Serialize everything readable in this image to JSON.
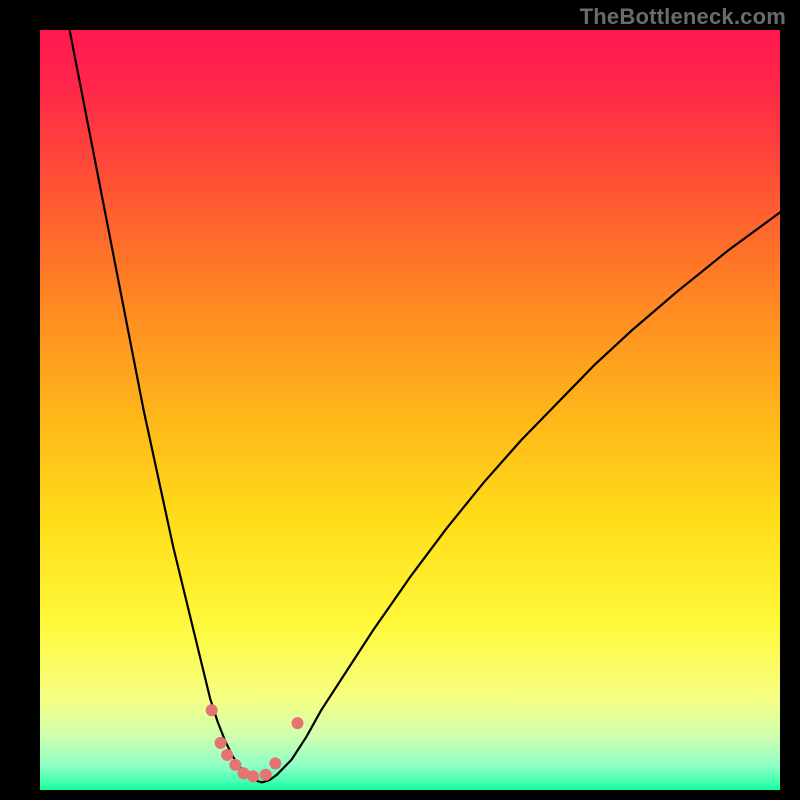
{
  "watermark": "TheBottleneck.com",
  "chart_data": {
    "type": "line",
    "title": "",
    "xlabel": "",
    "ylabel": "",
    "xlim": [
      0,
      100
    ],
    "ylim": [
      0,
      100
    ],
    "grid": false,
    "gradient_stops": [
      {
        "offset": 0.0,
        "color": "#ff1850"
      },
      {
        "offset": 0.08,
        "color": "#ff2848"
      },
      {
        "offset": 0.2,
        "color": "#ff5135"
      },
      {
        "offset": 0.35,
        "color": "#ff8523"
      },
      {
        "offset": 0.5,
        "color": "#ffb41a"
      },
      {
        "offset": 0.65,
        "color": "#ffde1a"
      },
      {
        "offset": 0.78,
        "color": "#fff83a"
      },
      {
        "offset": 0.88,
        "color": "#f6ff84"
      },
      {
        "offset": 0.93,
        "color": "#ceffb0"
      },
      {
        "offset": 0.97,
        "color": "#8affc6"
      },
      {
        "offset": 1.0,
        "color": "#19ff9f"
      }
    ],
    "series": [
      {
        "name": "bottleneck-curve",
        "stroke": "#000000",
        "stroke_width": 2.2,
        "x": [
          4,
          6,
          8,
          10,
          12,
          14,
          16,
          18,
          20,
          21,
          22,
          23,
          24,
          25,
          26,
          27,
          28,
          29,
          30,
          31,
          32,
          34,
          36,
          38,
          41,
          45,
          50,
          55,
          60,
          65,
          70,
          75,
          80,
          86,
          93,
          100
        ],
        "y": [
          100,
          90,
          80,
          70,
          60,
          50,
          41,
          32,
          24,
          20,
          16,
          12,
          9,
          6.5,
          4.5,
          3,
          2,
          1.3,
          1,
          1.3,
          2,
          4,
          7,
          10.5,
          15,
          21,
          28,
          34.5,
          40.5,
          46,
          51,
          56,
          60.5,
          65.5,
          71,
          76
        ]
      }
    ],
    "markers": {
      "color": "#e57373",
      "radius": 6,
      "points": [
        {
          "x": 23.2,
          "y": 10.5
        },
        {
          "x": 24.4,
          "y": 6.2
        },
        {
          "x": 25.3,
          "y": 4.6
        },
        {
          "x": 26.4,
          "y": 3.3
        },
        {
          "x": 27.5,
          "y": 2.2
        },
        {
          "x": 28.8,
          "y": 1.8
        },
        {
          "x": 30.5,
          "y": 2.0
        },
        {
          "x": 31.8,
          "y": 3.5
        },
        {
          "x": 34.8,
          "y": 8.8
        }
      ]
    },
    "baseline": {
      "color": "#19ff9f",
      "y": 0,
      "thickness": 3
    }
  }
}
